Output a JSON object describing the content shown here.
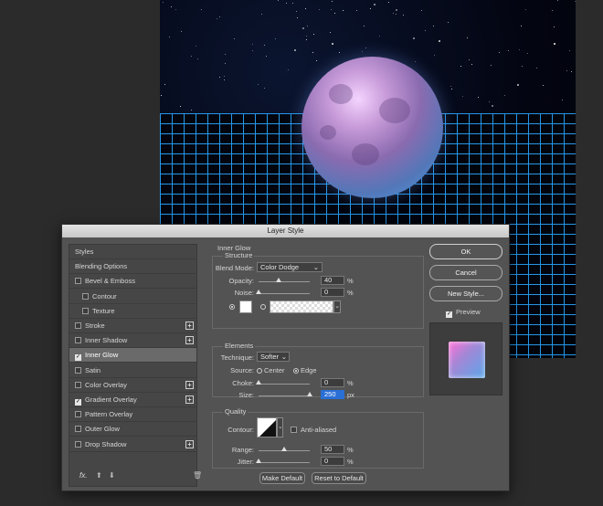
{
  "dialog": {
    "title": "Layer Style"
  },
  "sidebar": {
    "items": [
      {
        "label": "Styles",
        "checkbox": false,
        "checked": false,
        "plus": false,
        "indent": false,
        "selected": false
      },
      {
        "label": "Blending Options",
        "checkbox": false,
        "checked": false,
        "plus": false,
        "indent": false,
        "selected": false
      },
      {
        "label": "Bevel & Emboss",
        "checkbox": true,
        "checked": false,
        "plus": false,
        "indent": false,
        "selected": false
      },
      {
        "label": "Contour",
        "checkbox": true,
        "checked": false,
        "plus": false,
        "indent": true,
        "selected": false
      },
      {
        "label": "Texture",
        "checkbox": true,
        "checked": false,
        "plus": false,
        "indent": true,
        "selected": false
      },
      {
        "label": "Stroke",
        "checkbox": true,
        "checked": false,
        "plus": true,
        "indent": false,
        "selected": false
      },
      {
        "label": "Inner Shadow",
        "checkbox": true,
        "checked": false,
        "plus": true,
        "indent": false,
        "selected": false
      },
      {
        "label": "Inner Glow",
        "checkbox": true,
        "checked": true,
        "plus": false,
        "indent": false,
        "selected": true
      },
      {
        "label": "Satin",
        "checkbox": true,
        "checked": false,
        "plus": false,
        "indent": false,
        "selected": false
      },
      {
        "label": "Color Overlay",
        "checkbox": true,
        "checked": false,
        "plus": true,
        "indent": false,
        "selected": false
      },
      {
        "label": "Gradient Overlay",
        "checkbox": true,
        "checked": true,
        "plus": true,
        "indent": false,
        "selected": false
      },
      {
        "label": "Pattern Overlay",
        "checkbox": true,
        "checked": false,
        "plus": false,
        "indent": false,
        "selected": false
      },
      {
        "label": "Outer Glow",
        "checkbox": true,
        "checked": false,
        "plus": false,
        "indent": false,
        "selected": false
      },
      {
        "label": "Drop Shadow",
        "checkbox": true,
        "checked": false,
        "plus": true,
        "indent": false,
        "selected": false
      }
    ],
    "fx_label": "fx."
  },
  "inner_glow": {
    "heading": "Inner Glow",
    "structure": {
      "heading": "Structure",
      "blend_mode_label": "Blend Mode:",
      "blend_mode_value": "Color Dodge",
      "opacity_label": "Opacity:",
      "opacity_value": "40",
      "opacity_pct": 40,
      "noise_label": "Noise:",
      "noise_value": "0",
      "noise_pct": 0,
      "unit_pct": "%",
      "color_swatch": "#ffffff"
    },
    "elements": {
      "heading": "Elements",
      "technique_label": "Technique:",
      "technique_value": "Softer",
      "source_label": "Source:",
      "source_center": "Center",
      "source_edge": "Edge",
      "source_selected": "Edge",
      "choke_label": "Choke:",
      "choke_value": "0",
      "choke_pct": 0,
      "size_label": "Size:",
      "size_value": "250",
      "size_unit": "px",
      "size_fraction": 1.0
    },
    "quality": {
      "heading": "Quality",
      "contour_label": "Contour:",
      "anti_aliased_label": "Anti-aliased",
      "anti_aliased": false,
      "range_label": "Range:",
      "range_value": "50",
      "range_pct": 50,
      "jitter_label": "Jitter:",
      "jitter_value": "0",
      "jitter_pct": 0
    },
    "make_default": "Make Default",
    "reset_default": "Reset to Default"
  },
  "actions": {
    "ok": "OK",
    "cancel": "Cancel",
    "new_style": "New Style...",
    "preview_label": "Preview",
    "preview_checked": true
  }
}
